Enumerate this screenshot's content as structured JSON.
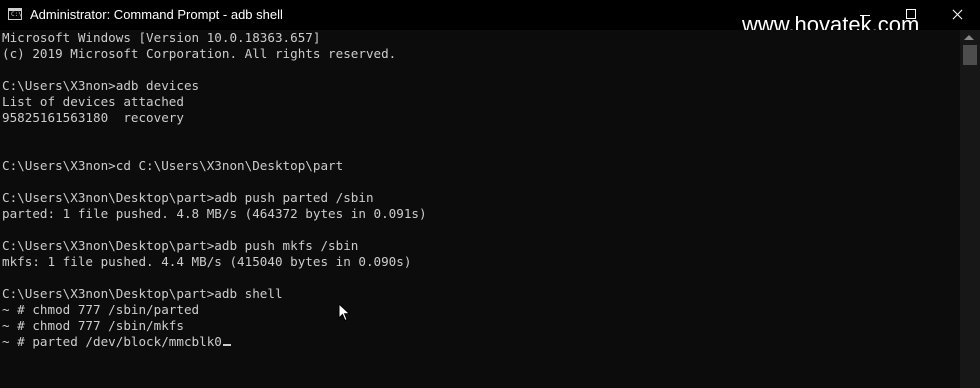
{
  "window": {
    "title": "Administrator: Command Prompt - adb  shell",
    "watermark": "www.hovatek.com",
    "app_icon_label": "C:\\"
  },
  "console": {
    "lines": [
      "Microsoft Windows [Version 10.0.18363.657]",
      "(c) 2019 Microsoft Corporation. All rights reserved.",
      "",
      "C:\\Users\\X3non>adb devices",
      "List of devices attached",
      "95825161563180  recovery",
      "",
      "",
      "C:\\Users\\X3non>cd C:\\Users\\X3non\\Desktop\\part",
      "",
      "C:\\Users\\X3non\\Desktop\\part>adb push parted /sbin",
      "parted: 1 file pushed. 4.8 MB/s (464372 bytes in 0.091s)",
      "",
      "C:\\Users\\X3non\\Desktop\\part>adb push mkfs /sbin",
      "mkfs: 1 file pushed. 4.4 MB/s (415040 bytes in 0.090s)",
      "",
      "C:\\Users\\X3non\\Desktop\\part>adb shell",
      "~ # chmod 777 /sbin/parted",
      "~ # chmod 777 /sbin/mkfs",
      "~ # parted /dev/block/mmcblk0"
    ]
  },
  "colors": {
    "background": "#0c0c0c",
    "text": "#cccccc",
    "titlebar": "#000000"
  },
  "icons": {
    "app": "cmd-icon",
    "minimize": "minimize-icon",
    "maximize": "maximize-icon",
    "close": "close-icon",
    "scroll_up": "scroll-up-arrow-icon",
    "pointer": "mouse-pointer-icon"
  }
}
